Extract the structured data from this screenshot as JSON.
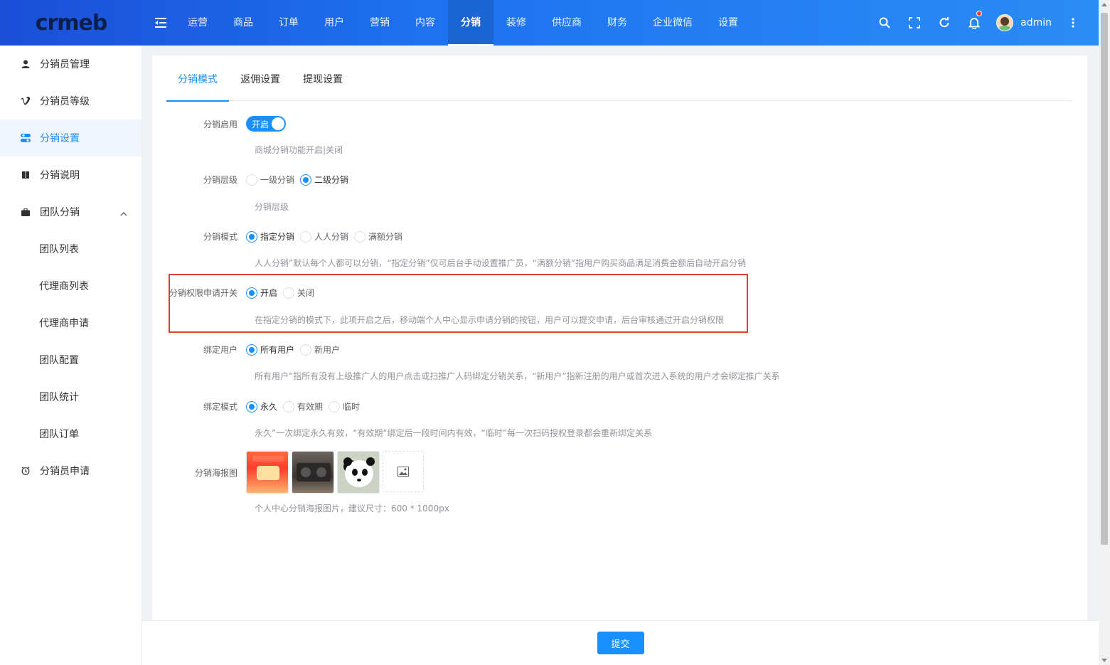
{
  "brand": {
    "logo_text": "crmeb"
  },
  "nav": {
    "items": [
      {
        "label": "运营"
      },
      {
        "label": "商品"
      },
      {
        "label": "订单"
      },
      {
        "label": "用户"
      },
      {
        "label": "营销"
      },
      {
        "label": "内容"
      },
      {
        "label": "分销"
      },
      {
        "label": "装修"
      },
      {
        "label": "供应商"
      },
      {
        "label": "财务"
      },
      {
        "label": "企业微信"
      },
      {
        "label": "设置"
      }
    ],
    "active_index": 6
  },
  "header": {
    "username": "admin",
    "notification_badge": true
  },
  "sidebar": {
    "items": [
      {
        "label": "分销员管理",
        "icon": "user-icon"
      },
      {
        "label": "分销员等级",
        "icon": "vimeo-icon"
      },
      {
        "label": "分销设置",
        "icon": "toggle-icon",
        "active": true
      },
      {
        "label": "分销说明",
        "icon": "book-icon"
      },
      {
        "label": "团队分销",
        "icon": "briefcase-icon",
        "expanded": true
      },
      {
        "label": "分销员申请",
        "icon": "clock-icon"
      }
    ],
    "team_sub": [
      "团队列表",
      "代理商列表",
      "代理商申请",
      "团队配置",
      "团队统计",
      "团队订单"
    ]
  },
  "tabs": [
    "分销模式",
    "返佣设置",
    "提现设置"
  ],
  "form": {
    "enable": {
      "label": "分销启用",
      "switch_text": "开启",
      "help": "商城分销功能开启|关闭"
    },
    "level": {
      "label": "分销层级",
      "options": [
        "一级分销",
        "二级分销"
      ],
      "selected": "二级分销",
      "help": "分销层级"
    },
    "mode": {
      "label": "分销模式",
      "options": [
        "指定分销",
        "人人分销",
        "满额分销"
      ],
      "selected": "指定分销",
      "help": "人人分销”默认每个人都可以分销，“指定分销”仅可后台手动设置推广员，“满额分销”指用户购买商品满足消费金额后自动开启分销"
    },
    "apply": {
      "label": "分销权限申请开关",
      "options": [
        "开启",
        "关闭"
      ],
      "selected": "开启",
      "help": "在指定分销的模式下，此项开启之后，移动端个人中心显示申请分销的按钮，用户可以提交申请，后台审核通过开启分销权限"
    },
    "bind_user": {
      "label": "绑定用户",
      "options": [
        "所有用户",
        "新用户"
      ],
      "selected": "所有用户",
      "help": "所有用户”指所有没有上级推广人的用户点击或扫推广人码绑定分销关系，“新用户”指新注册的用户或首次进入系统的用户才会绑定推广关系"
    },
    "bind_mode": {
      "label": "绑定模式",
      "options": [
        "永久",
        "有效期",
        "临时"
      ],
      "selected": "永久",
      "help": "永久”一次绑定永久有效，“有效期”绑定后一段时间内有效，“临时”每一次扫码授权登录都会重新绑定关系"
    },
    "poster": {
      "label": "分销海报图",
      "help": "个人中心分销海报图片，建议尺寸：600 * 1000px"
    }
  },
  "footer": {
    "submit_label": "提交"
  },
  "colors": {
    "primary": "#1890ff",
    "header_gradient_start": "#1a4fd8",
    "header_gradient_end": "#2a8cf6",
    "highlight": "#e53935"
  }
}
